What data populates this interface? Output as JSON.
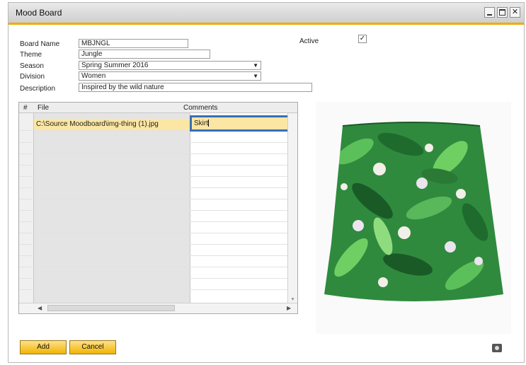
{
  "window": {
    "title": "Mood Board"
  },
  "form": {
    "board_name": {
      "label": "Board Name",
      "value": "MBJNGL"
    },
    "theme": {
      "label": "Theme",
      "value": "Jungle"
    },
    "season": {
      "label": "Season",
      "value": "Spring Summer 2016"
    },
    "division": {
      "label": "Division",
      "value": "Women"
    },
    "description": {
      "label": "Description",
      "value": "Inspired by the wild nature"
    },
    "active": {
      "label": "Active",
      "checked": true
    }
  },
  "grid": {
    "columns": [
      "#",
      "File",
      "Comments"
    ],
    "rows": [
      {
        "file": "C:\\Source Moodboard\\img-thing (1).jpg",
        "comment": "Skirt"
      }
    ]
  },
  "buttons": {
    "add": "Add",
    "cancel": "Cancel"
  },
  "colors": {
    "accent": "#f0ab00",
    "selection": "#3b6eb5",
    "row_highlight": "#fbe6a3"
  },
  "icons": [
    "minimize-icon",
    "maximize-icon",
    "close-icon",
    "camera-icon",
    "chevron-down-icon"
  ]
}
